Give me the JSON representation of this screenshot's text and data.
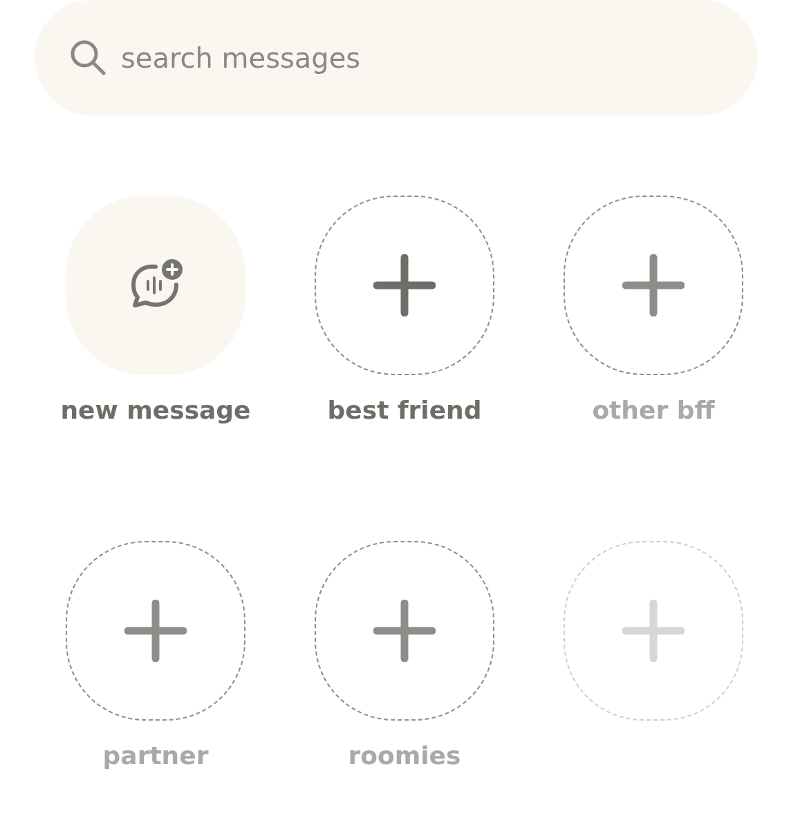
{
  "search": {
    "placeholder": "search messages"
  },
  "tiles": [
    {
      "kind": "new",
      "label": "new message",
      "active": true
    },
    {
      "kind": "slot",
      "label": "best friend",
      "active": true
    },
    {
      "kind": "slot",
      "label": "other bff",
      "active": false
    },
    {
      "kind": "slot",
      "label": "partner",
      "active": false
    },
    {
      "kind": "slot",
      "label": "roomies",
      "active": false
    },
    {
      "kind": "slot",
      "disabled": true
    }
  ]
}
